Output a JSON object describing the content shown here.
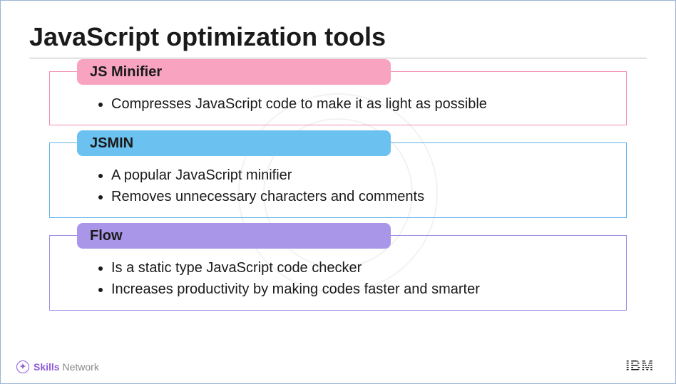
{
  "title": "JavaScript optimization tools",
  "cards": [
    {
      "header": "JS Minifier",
      "items": [
        "Compresses JavaScript code to make it as light as possible"
      ]
    },
    {
      "header": "JSMIN",
      "items": [
        "A popular JavaScript minifier",
        "Removes unnecessary characters and comments"
      ]
    },
    {
      "header": "Flow",
      "items": [
        "Is a static type JavaScript code checker",
        "Increases productivity by making codes faster and smarter"
      ]
    }
  ],
  "footer": {
    "skills_bold": "Skills",
    "skills_light": "Network",
    "ibm": "IBM"
  }
}
